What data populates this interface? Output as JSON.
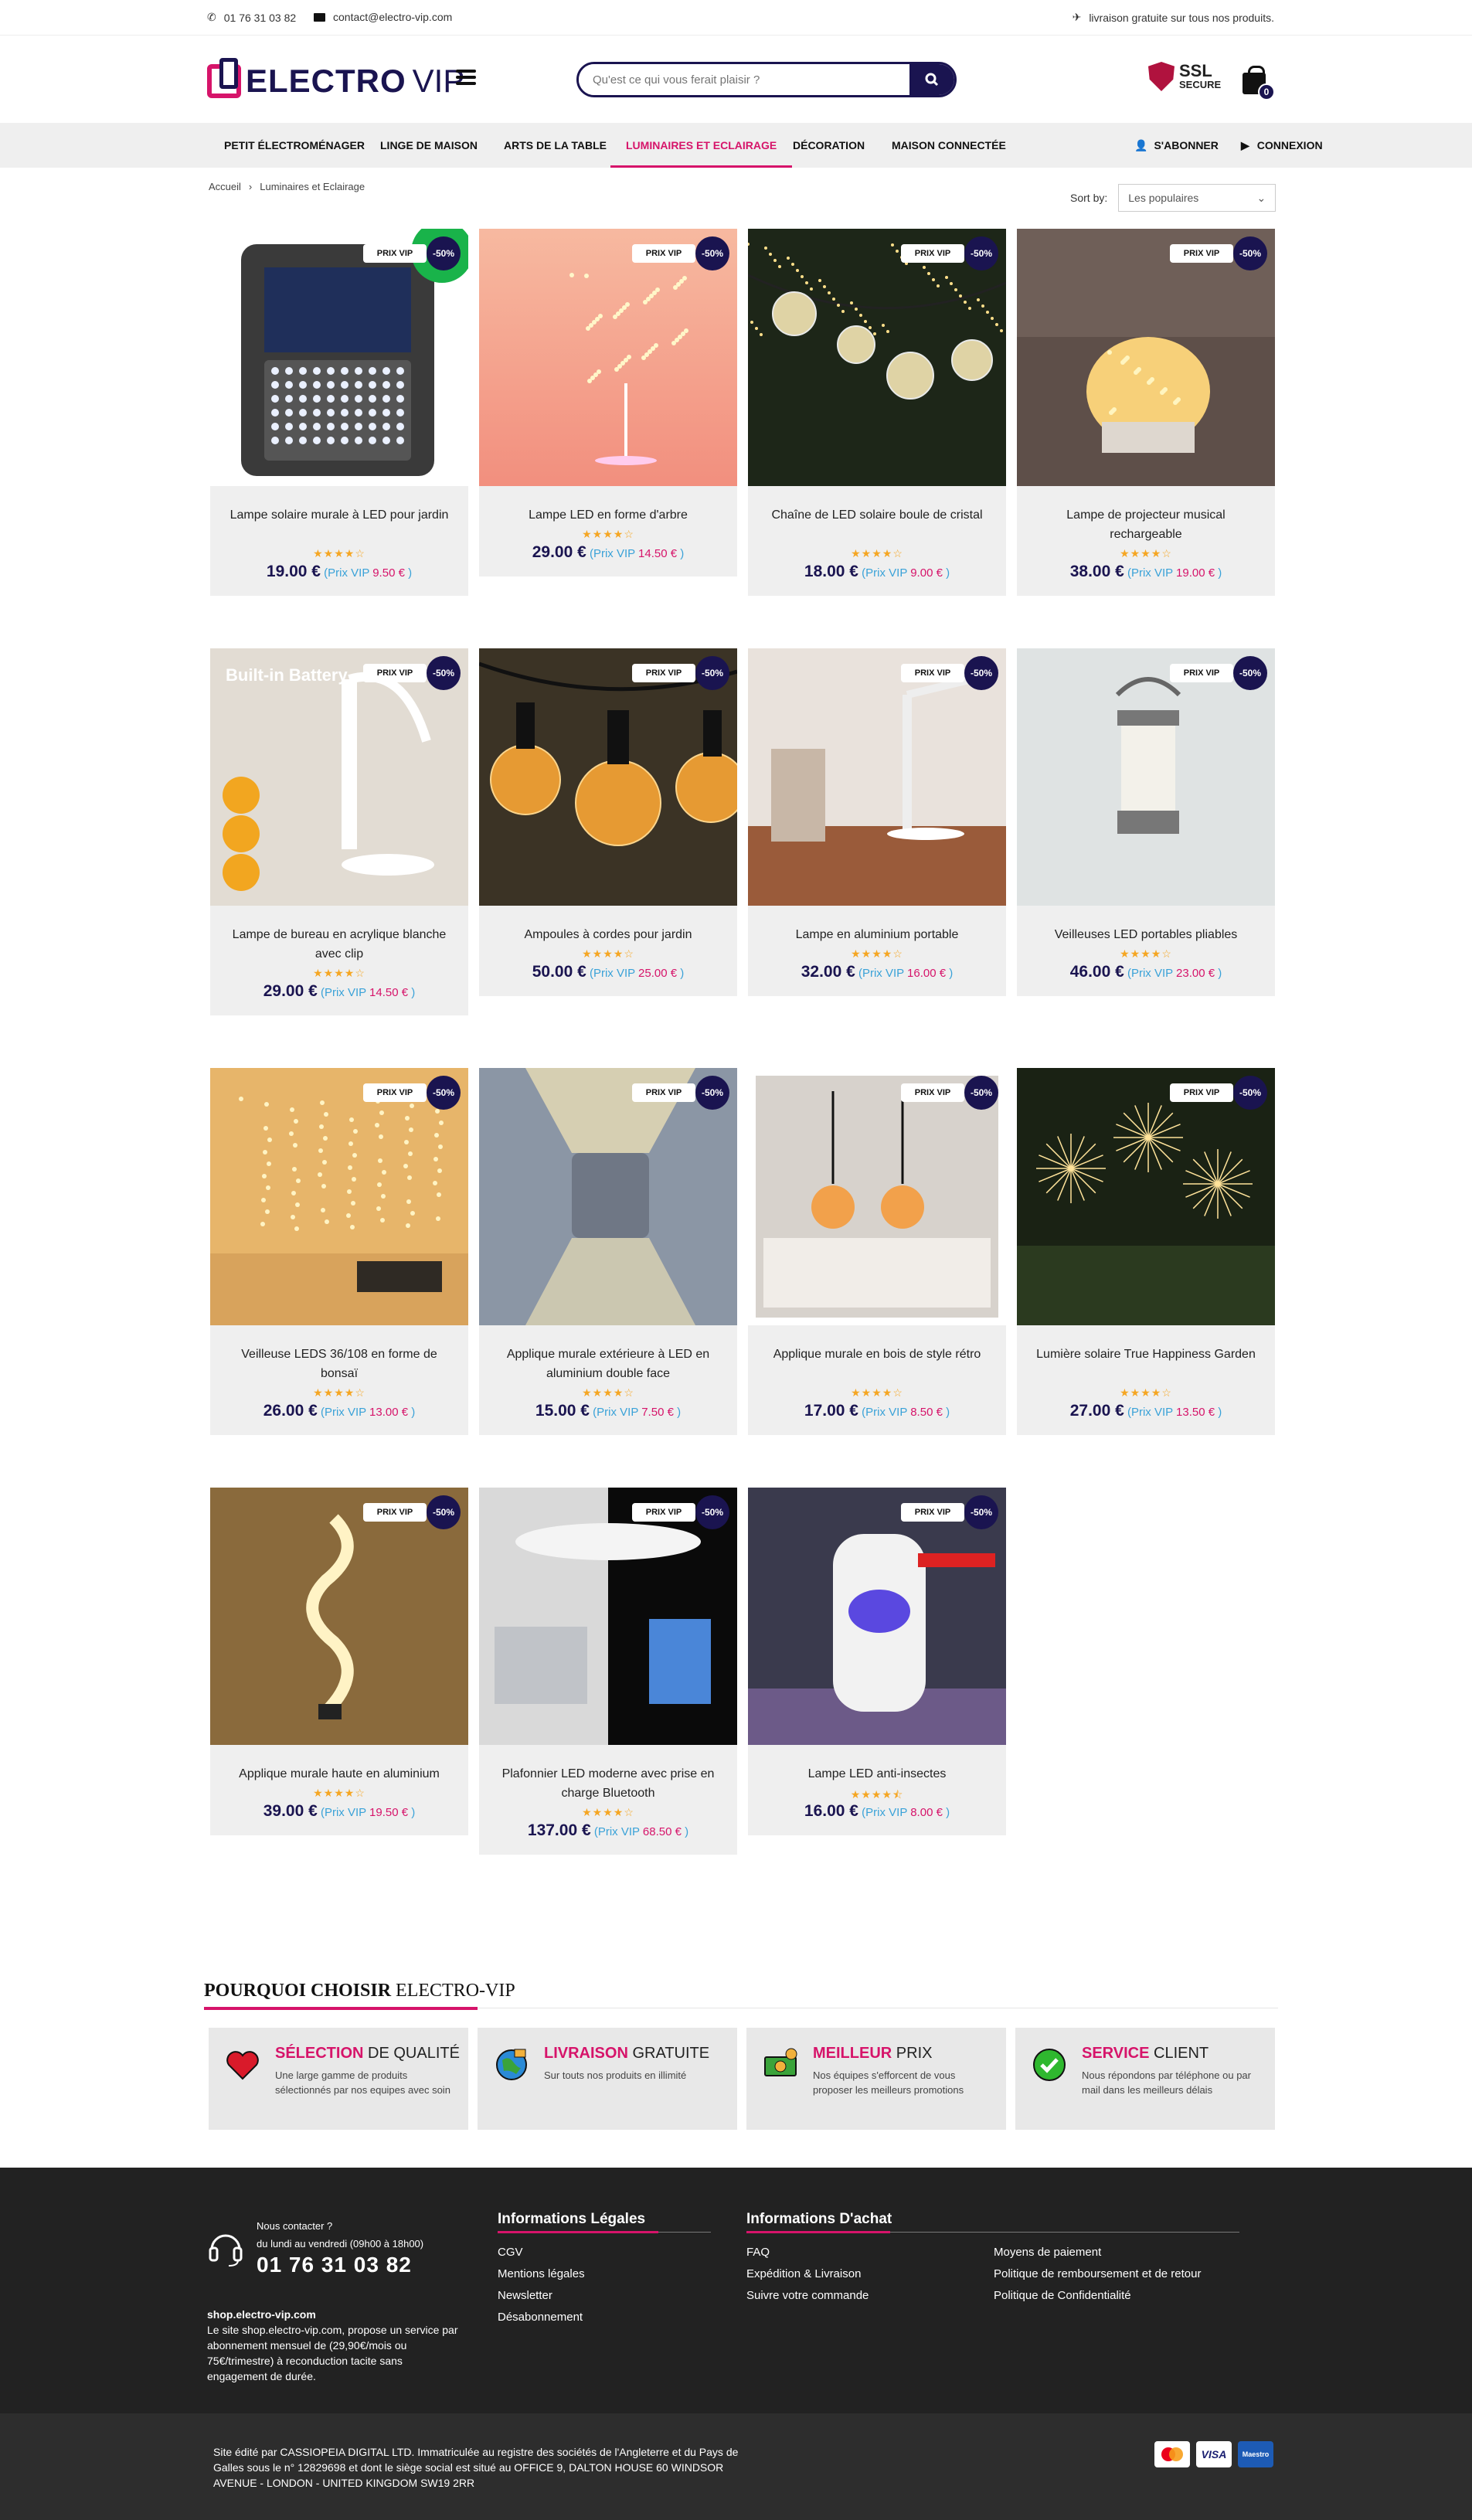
{
  "topbar": {
    "phone": "01 76 31 03 82",
    "email": "contact@electro-vip.com",
    "shipping": "livraison gratuite sur tous nos produits."
  },
  "header": {
    "logo_main": "ELECTRO",
    "logo_vip": "VIP",
    "search_placeholder": "Qu'est ce qui vous ferait plaisir ?",
    "ssl_title": "SSL",
    "ssl_sub": "SECURE",
    "cart_count": "0"
  },
  "nav": {
    "items": [
      "PETIT ÉLECTROMÉNAGER",
      "LINGE DE MAISON",
      "ARTS DE LA TABLE",
      "LUMINAIRES ET ECLAIRAGE",
      "DÉCORATION",
      "MAISON CONNECTÉE"
    ],
    "subscribe": "S'ABONNER",
    "login": "CONNEXION"
  },
  "breadcrumb": {
    "home": "Accueil",
    "sep": "›",
    "current": "Luminaires et Eclairage"
  },
  "sort": {
    "label": "Sort by:",
    "value": "Les populaires"
  },
  "badges": {
    "vip": "PRIX VIP",
    "pct": "-50%"
  },
  "vip_label": "Prix VIP",
  "products": [
    {
      "name": "Lampe solaire murale à LED pour jardin",
      "price": "19.00 €",
      "vip": "9.50 €",
      "rating": 4,
      "stars": "★★★★☆"
    },
    {
      "name": "Lampe LED en forme d'arbre",
      "price": "29.00 €",
      "vip": "14.50 €",
      "rating": 4,
      "stars": "★★★★☆"
    },
    {
      "name": "Chaîne de LED solaire boule de cristal",
      "price": "18.00 €",
      "vip": "9.00 €",
      "rating": 4,
      "stars": "★★★★☆"
    },
    {
      "name": "Lampe de projecteur musical rechargeable",
      "price": "38.00 €",
      "vip": "19.00 €",
      "rating": 4,
      "stars": "★★★★☆"
    },
    {
      "name": "Lampe de bureau en acrylique blanche avec clip",
      "price": "29.00 €",
      "vip": "14.50 €",
      "rating": 4,
      "stars": "★★★★☆"
    },
    {
      "name": "Ampoules à cordes pour jardin",
      "price": "50.00 €",
      "vip": "25.00 €",
      "rating": 4,
      "stars": "★★★★☆"
    },
    {
      "name": "Lampe en aluminium portable",
      "price": "32.00 €",
      "vip": "16.00 €",
      "rating": 4,
      "stars": "★★★★☆"
    },
    {
      "name": "Veilleuses LED portables pliables",
      "price": "46.00 €",
      "vip": "23.00 €",
      "rating": 4,
      "stars": "★★★★☆"
    },
    {
      "name": "Veilleuse LEDS 36/108 en forme de bonsaï",
      "price": "26.00 €",
      "vip": "13.00 €",
      "rating": 4,
      "stars": "★★★★☆"
    },
    {
      "name": "Applique murale extérieure à LED en aluminium double face",
      "price": "15.00 €",
      "vip": "7.50 €",
      "rating": 4,
      "stars": "★★★★☆"
    },
    {
      "name": "Applique murale en bois de style rétro",
      "price": "17.00 €",
      "vip": "8.50 €",
      "rating": 4,
      "stars": "★★★★☆"
    },
    {
      "name": "Lumière solaire True Happiness Garden",
      "price": "27.00 €",
      "vip": "13.50 €",
      "rating": 4,
      "stars": "★★★★☆"
    },
    {
      "name": "Applique murale haute en aluminium",
      "price": "39.00 €",
      "vip": "19.50 €",
      "rating": 4,
      "stars": "★★★★☆"
    },
    {
      "name": "Plafonnier LED moderne avec prise en charge Bluetooth",
      "price": "137.00 €",
      "vip": "68.50 €",
      "rating": 4,
      "stars": "★★★★☆"
    },
    {
      "name": "Lampe LED anti-insectes",
      "price": "16.00 €",
      "vip": "8.00 €",
      "rating": 4.5,
      "stars": "★★★★⯪"
    }
  ],
  "why": {
    "title_a": "POURQUOI CHOISIR",
    "title_b": "ELECTRO-VIP",
    "features": [
      {
        "hl": "SÉLECTION",
        "rest": "DE QUALITÉ",
        "desc": "Une large gamme de produits sélectionnés par nos equipes avec soin",
        "icon": "heart-icon"
      },
      {
        "hl": "LIVRAISON",
        "rest": "GRATUITE",
        "desc": "Sur touts nos produits en illimité",
        "icon": "globe-delivery-icon"
      },
      {
        "hl": "MEILLEUR",
        "rest": "PRIX",
        "desc": "Nos équipes s'efforcent de vous proposer les meilleurs promotions",
        "icon": "money-icon"
      },
      {
        "hl": "SERVICE",
        "rest": "CLIENT",
        "desc": "Nous répondons par téléphone ou par mail dans les meilleurs délais",
        "icon": "check-icon"
      }
    ]
  },
  "footer": {
    "contact_q": "Nous contacter ?",
    "hours": "du lundi au vendredi (09h00 à 18h00)",
    "phone": "01 76 31 03 82",
    "site": "shop.electro-vip.com",
    "desc": "Le site shop.electro-vip.com, propose un service par abonnement mensuel de (29,90€/mois ou 75€/trimestre) à reconduction tacite sans engagement de durée.",
    "legal_title": "Informations Légales",
    "legal_links": [
      "CGV",
      "Mentions légales",
      "Newsletter",
      "Désabonnement"
    ],
    "buy_title": "Informations D'achat",
    "buy_links_a": [
      "FAQ",
      "Expédition & Livraison",
      "Suivre votre commande"
    ],
    "buy_links_b": [
      "Moyens de paiement",
      "Politique de remboursement et de retour",
      "Politique de Confidentialité"
    ],
    "legal_text": "Site édité par CASSIOPEIA DIGITAL LTD. Immatriculée au registre des sociétés de l'Angleterre et du Pays de Galles sous le n° 12829698 et dont le siège social est situé au OFFICE 9, DALTON HOUSE 60 WINDSOR AVENUE - LONDON - UNITED KINGDOM SW19 2RR",
    "payments": [
      "mastercard",
      "VISA",
      "Maestro"
    ]
  },
  "colors": {
    "brand": "#1a1450",
    "accent": "#d6146a",
    "star": "#f5a623",
    "vip_label": "#3aa2d8"
  }
}
